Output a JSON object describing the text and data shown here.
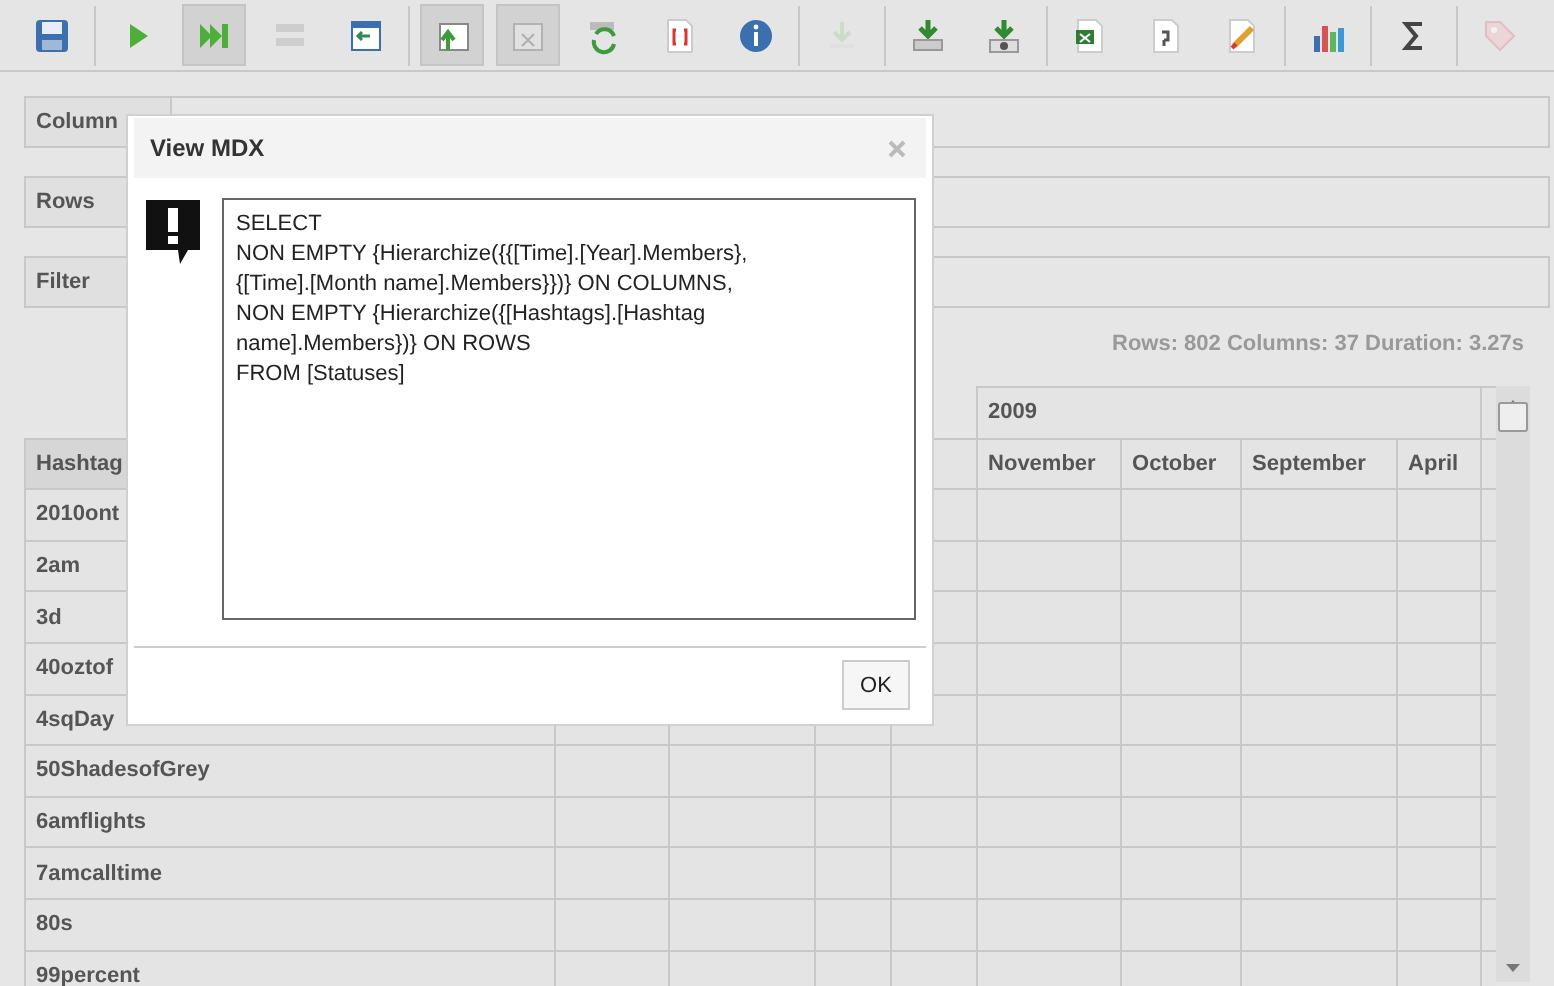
{
  "toolbar": {
    "buttons": [
      {
        "kind": "save",
        "pressed": false,
        "disabled": false
      },
      {
        "kind": "separator"
      },
      {
        "kind": "run",
        "pressed": false,
        "disabled": false
      },
      {
        "kind": "run-all",
        "pressed": true,
        "disabled": false
      },
      {
        "kind": "list",
        "pressed": false,
        "disabled": true
      },
      {
        "kind": "panel",
        "pressed": false,
        "disabled": false
      },
      {
        "kind": "separator"
      },
      {
        "kind": "table-up",
        "pressed": true,
        "disabled": false
      },
      {
        "kind": "table-x",
        "pressed": true,
        "disabled": true
      },
      {
        "kind": "refresh",
        "pressed": false,
        "disabled": false
      },
      {
        "kind": "brackets",
        "pressed": false,
        "disabled": false
      },
      {
        "kind": "info",
        "pressed": false,
        "disabled": false
      },
      {
        "kind": "separator"
      },
      {
        "kind": "download",
        "pressed": false,
        "disabled": true
      },
      {
        "kind": "separator"
      },
      {
        "kind": "export",
        "pressed": false,
        "disabled": false
      },
      {
        "kind": "export-alt",
        "pressed": false,
        "disabled": false
      },
      {
        "kind": "separator"
      },
      {
        "kind": "sheet",
        "pressed": false,
        "disabled": false
      },
      {
        "kind": "doc",
        "pressed": false,
        "disabled": false
      },
      {
        "kind": "edit",
        "pressed": false,
        "disabled": false
      },
      {
        "kind": "separator"
      },
      {
        "kind": "chart",
        "pressed": false,
        "disabled": false
      },
      {
        "kind": "separator"
      },
      {
        "kind": "sigma",
        "pressed": false,
        "disabled": false
      },
      {
        "kind": "separator"
      },
      {
        "kind": "tag",
        "pressed": false,
        "disabled": true
      }
    ]
  },
  "drop_zones": [
    {
      "label": "Column"
    },
    {
      "label": "Rows"
    },
    {
      "label": "Filter"
    }
  ],
  "stats": "Rows: 802 Columns: 37 Duration: 3.27s",
  "table": {
    "group_header": "2009",
    "columns": [
      "Hashtag",
      "",
      "",
      "",
      "",
      "November",
      "October",
      "September",
      "April",
      ""
    ],
    "rows": [
      "2010ont",
      "2am",
      "3d",
      "40oztof",
      "4sqDay",
      "50ShadesofGrey",
      "6amflights",
      "7amcalltime",
      "80s",
      "99percent"
    ]
  },
  "dialog": {
    "title": "View MDX",
    "query_lines": [
      "SELECT",
      "NON EMPTY {Hierarchize({{[Time].[Year].Members},",
      "{[Time].[Month name].Members}})} ON COLUMNS,",
      "NON EMPTY {Hierarchize({[Hashtags].[Hashtag",
      "name].Members})} ON ROWS",
      "FROM [Statuses]"
    ],
    "ok_button": "OK"
  }
}
